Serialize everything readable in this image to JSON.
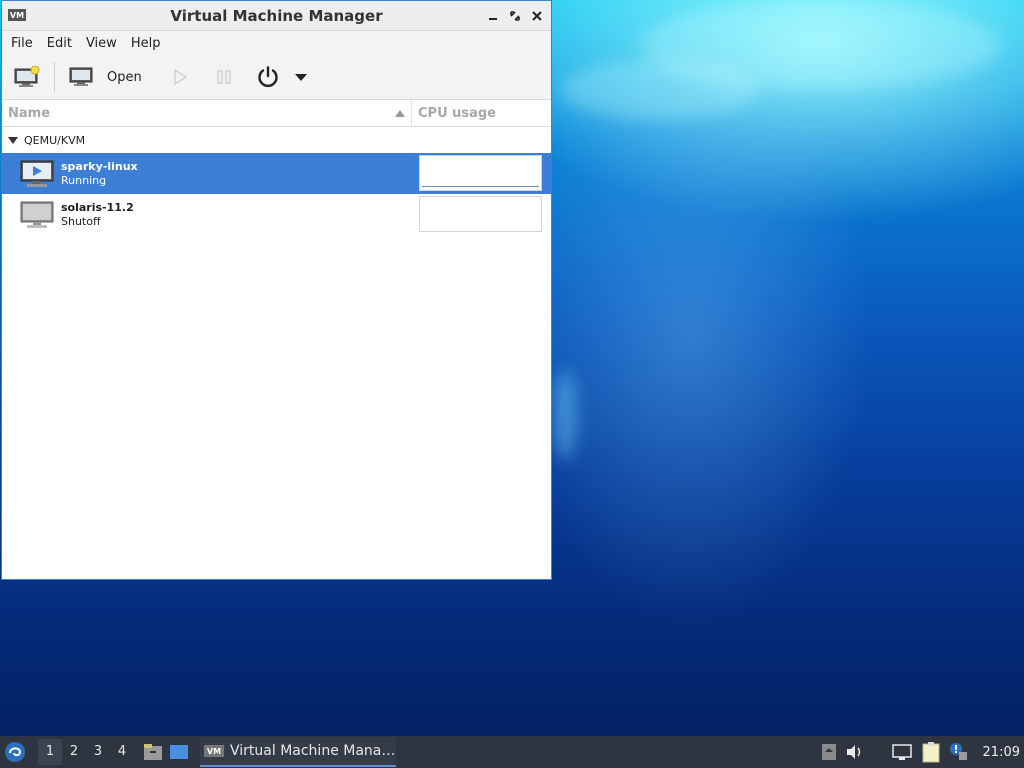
{
  "window": {
    "title": "Virtual Machine Manager",
    "controls": [
      "minimize-icon",
      "maximize-icon",
      "close-icon"
    ]
  },
  "menu": [
    "File",
    "Edit",
    "View",
    "Help"
  ],
  "toolbar": {
    "new_vm_icon": "new-vm-icon",
    "open_label": "Open",
    "run_icon": "play-icon",
    "pause_icon": "pause-icon",
    "power_icon": "power-icon",
    "dropdown_icon": "chevron-down-icon"
  },
  "columns": {
    "name": "Name",
    "cpu": "CPU usage"
  },
  "group": {
    "label": "QEMU/KVM"
  },
  "vms": [
    {
      "name": "sparky-linux",
      "status": "Running",
      "selected": true
    },
    {
      "name": "solaris-11.2",
      "status": "Shutoff",
      "selected": false
    }
  ],
  "taskbar": {
    "workspaces": [
      "1",
      "2",
      "3",
      "4"
    ],
    "active_workspace": "1",
    "task_label": "Virtual Machine Mana…",
    "clock": "21:09"
  },
  "colors": {
    "selection": "#3d7fd6",
    "taskbar": "#2e3440"
  }
}
